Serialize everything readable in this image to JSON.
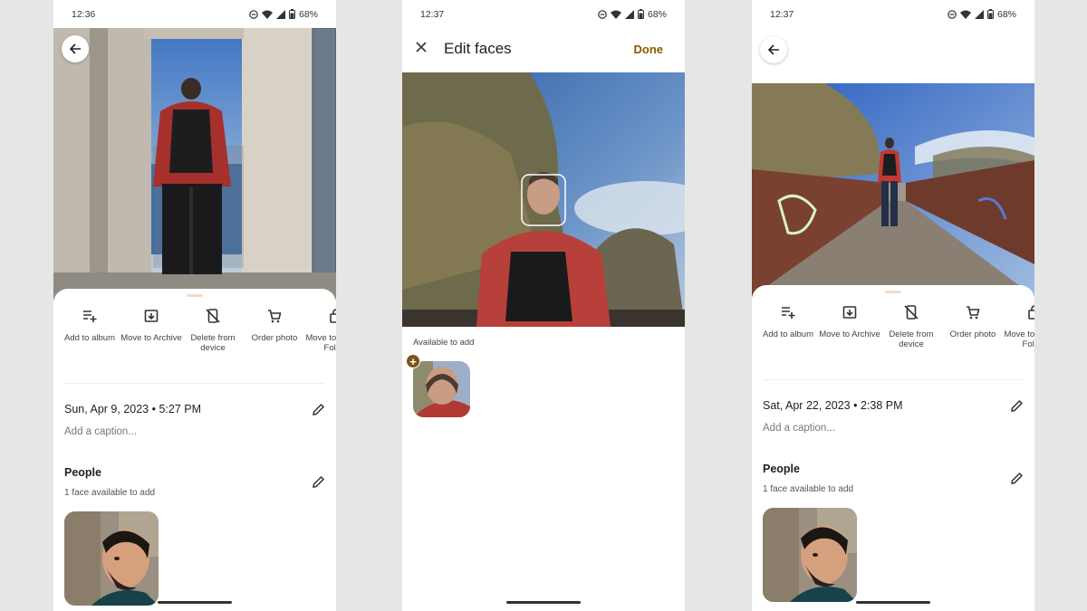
{
  "screen1": {
    "status": {
      "time": "12:36",
      "battery": "68%"
    },
    "actions": [
      {
        "label": "Add to album",
        "icon": "playlist-add-icon"
      },
      {
        "label": "Move to Archive",
        "icon": "archive-icon"
      },
      {
        "label": "Delete from device",
        "icon": "delete-device-icon"
      },
      {
        "label": "Order photo",
        "icon": "cart-icon"
      },
      {
        "label": "Move to Locked Folder",
        "icon": "lock-folder-icon"
      }
    ],
    "date": "Sun, Apr 9, 2023",
    "time": "5:27 PM",
    "caption_placeholder": "Add a caption...",
    "people_title": "People",
    "people_sub": "1 face available to add"
  },
  "screen2": {
    "status": {
      "time": "12:37",
      "battery": "68%"
    },
    "title": "Edit faces",
    "done_label": "Done",
    "available_label": "Available to add"
  },
  "screen3": {
    "status": {
      "time": "12:37",
      "battery": "68%"
    },
    "actions": [
      {
        "label": "Add to album",
        "icon": "playlist-add-icon"
      },
      {
        "label": "Move to Archive",
        "icon": "archive-icon"
      },
      {
        "label": "Delete from device",
        "icon": "delete-device-icon"
      },
      {
        "label": "Order photo",
        "icon": "cart-icon"
      },
      {
        "label": "Move to Locked Folder",
        "icon": "lock-folder-icon"
      }
    ],
    "date": "Sat, Apr 22, 2023",
    "time": "2:38 PM",
    "caption_placeholder": "Add a caption...",
    "people_title": "People",
    "people_sub": "1 face available to add"
  },
  "colors": {
    "accent": "#8a5a00",
    "badge": "#7a5518",
    "background": "#e6e6e6"
  }
}
